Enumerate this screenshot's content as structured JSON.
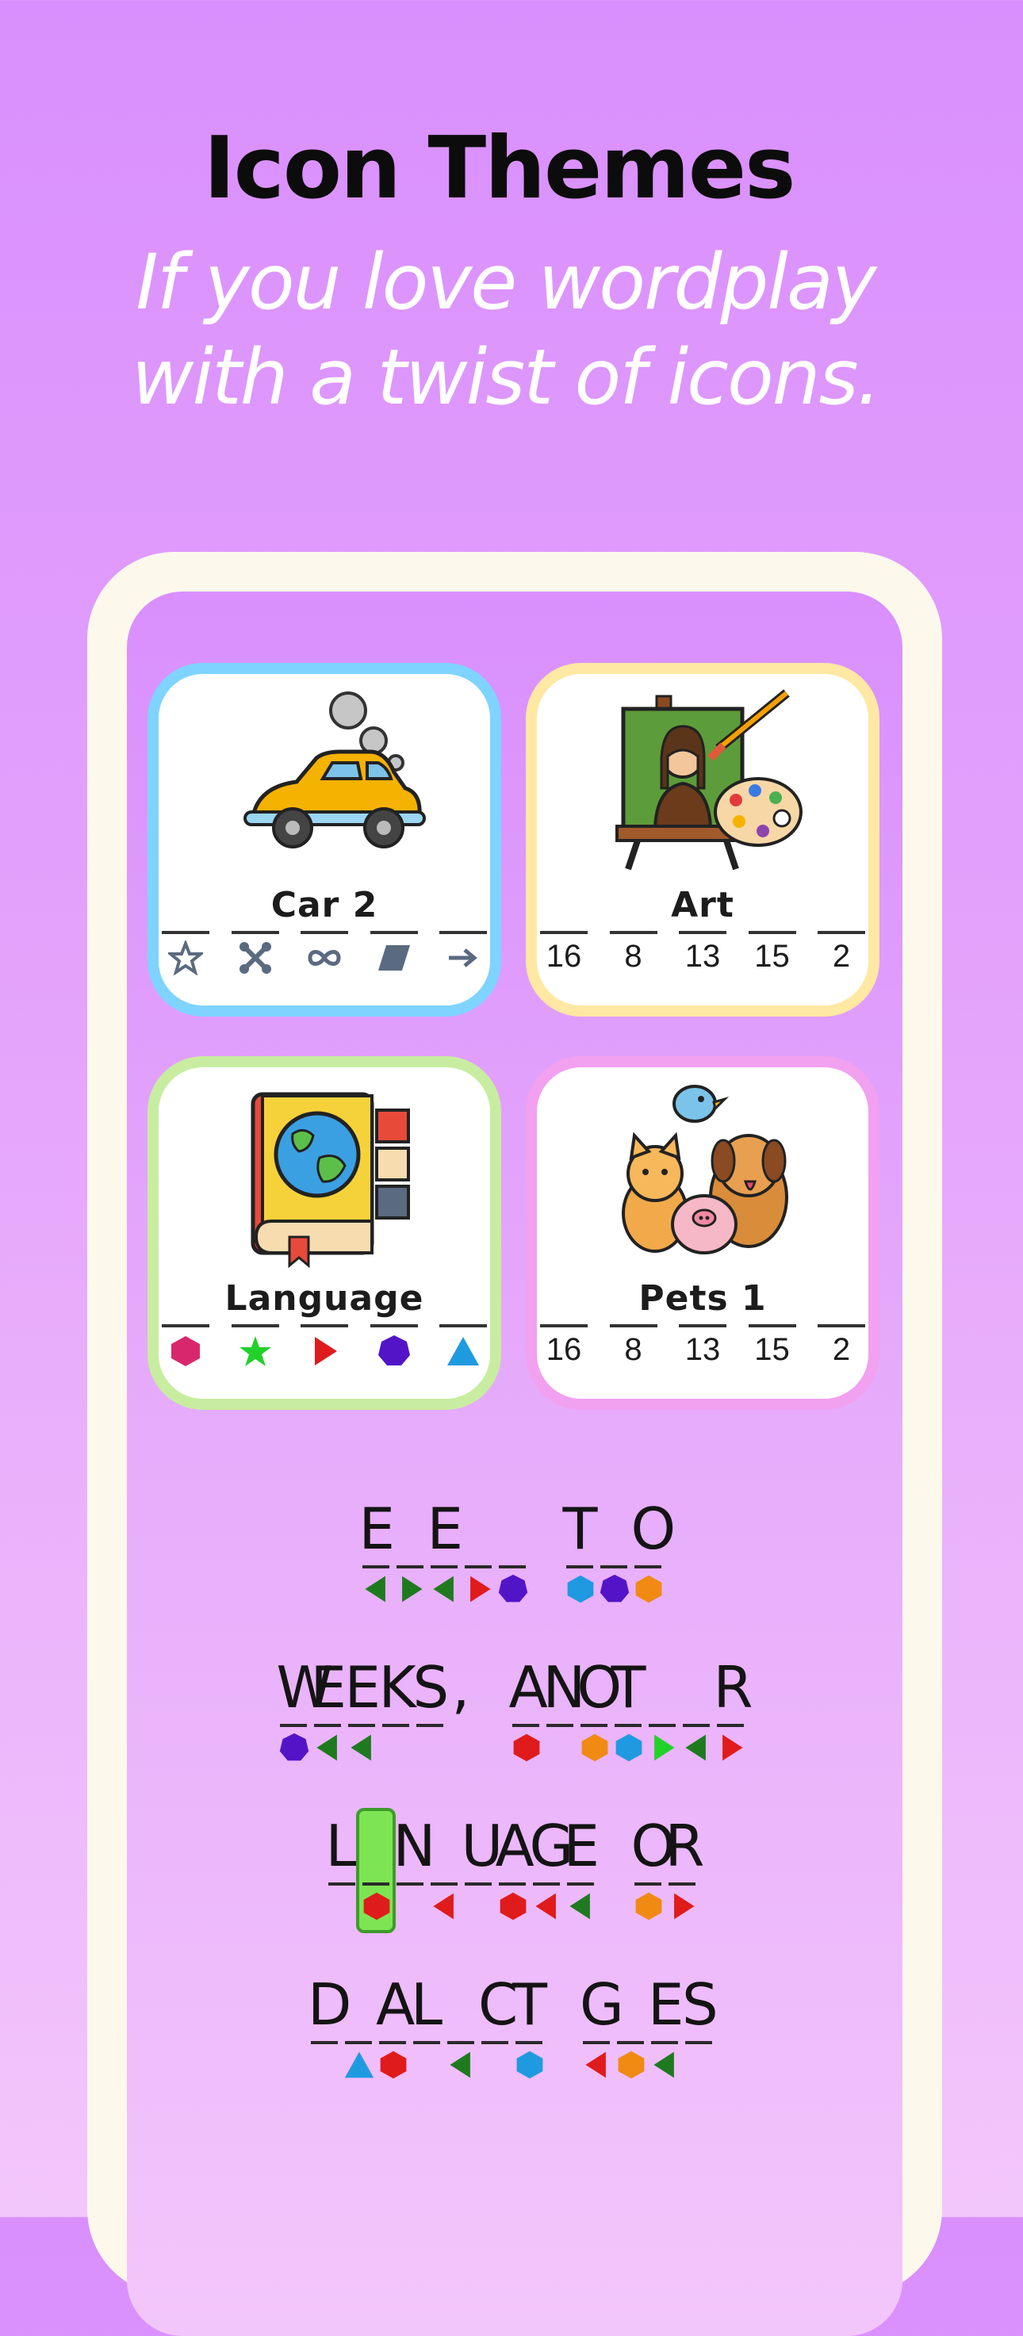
{
  "header": {
    "title": "Icon Themes",
    "subtitle_line1": "If you love wordplay",
    "subtitle_line2": "with a twist of icons."
  },
  "cards": [
    {
      "title": "Car 2",
      "slot_icons": [
        "star-outline-icon",
        "scissors-icon",
        "infinity-icon",
        "parallelogram-icon",
        "arrow-right-icon"
      ]
    },
    {
      "title": "Art",
      "slot_values": [
        "16",
        "8",
        "13",
        "15",
        "2"
      ]
    },
    {
      "title": "Language",
      "slot_icons": [
        "hexagon-pink-icon",
        "star-green-icon",
        "triangle-red-icon",
        "heptagon-purple-icon",
        "triangle-blue-icon"
      ]
    },
    {
      "title": "Pets 1",
      "slot_values": [
        "16",
        "8",
        "13",
        "15",
        "2"
      ]
    }
  ],
  "colors": {
    "background_top": "#d98ffd",
    "background_bottom": "#f3c6fb",
    "phone_frame": "#fdf8ec",
    "card_borders": [
      "#7fd3ff",
      "#ffe8a3",
      "#c8eda0",
      "#f2a0f0"
    ],
    "selected_cell": "#7de553"
  },
  "puzzle": {
    "row1": [
      "E",
      "",
      "E",
      "",
      "",
      "",
      "T",
      "",
      "O"
    ],
    "row2": [
      "W",
      "E",
      "E",
      "K",
      "S",
      ",",
      "A",
      "N",
      "O",
      "T",
      "",
      "",
      "R"
    ],
    "row3": [
      "L",
      "",
      "N",
      "",
      "U",
      "A",
      "G",
      "E",
      "O",
      "R"
    ],
    "row4": [
      "D",
      "",
      "A",
      "L",
      "",
      "C",
      "T",
      "G",
      "",
      "E",
      "S"
    ]
  }
}
